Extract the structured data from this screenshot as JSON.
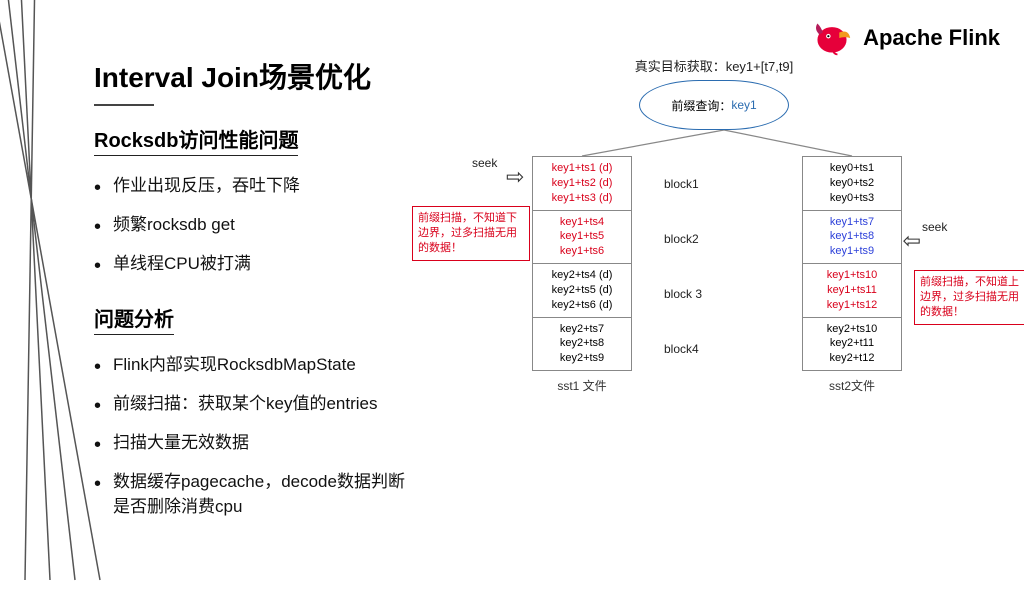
{
  "brand": "Apache Flink",
  "title": "Interval Join场景优化",
  "section1": {
    "heading": "Rocksdb访问性能问题",
    "items": [
      "作业出现反压，吞吐下降",
      "频繁rocksdb get",
      "单线程CPU被打满"
    ]
  },
  "section2": {
    "heading": "问题分析",
    "items": [
      "Flink内部实现RocksdbMapState",
      "前缀扫描：获取某个key值的entries",
      "扫描大量无效数据",
      "数据缓存pagecache，decode数据判断是否删除消费cpu"
    ]
  },
  "diagram": {
    "target": "真实目标获取：key1+[t7,t9]",
    "cloud_prefix": "前缀查询：",
    "cloud_key": "key1",
    "seek": "seek",
    "sst1_caption": "sst1 文件",
    "sst2_caption": "sst2文件",
    "blocks": [
      "block1",
      "block2",
      "block 3",
      "block4"
    ],
    "left_cells": [
      {
        "lines": [
          "key1+ts1 (d)",
          "key1+ts2 (d)",
          "key1+ts3 (d)"
        ],
        "cls": "red"
      },
      {
        "lines": [
          "key1+ts4",
          "key1+ts5",
          "key1+ts6"
        ],
        "cls": "red"
      },
      {
        "lines": [
          "key2+ts4 (d)",
          "key2+ts5 (d)",
          "key2+ts6 (d)"
        ],
        "cls": "black"
      },
      {
        "lines": [
          "key2+ts7",
          "key2+ts8",
          "key2+ts9"
        ],
        "cls": "black"
      }
    ],
    "right_cells": [
      {
        "lines": [
          "key0+ts1",
          "key0+ts2",
          "key0+ts3"
        ],
        "cls": "black"
      },
      {
        "lines": [
          "key1+ts7",
          "key1+ts8",
          "key1+ts9"
        ],
        "cls": "blue"
      },
      {
        "lines": [
          "key1+ts10",
          "key1+ts11",
          "key1+ts12"
        ],
        "cls": "red"
      },
      {
        "lines": [
          "key2+ts10",
          "key2+t11",
          "key2+t12"
        ],
        "cls": "black"
      }
    ],
    "callout_left": "前缀扫描，不知道下边界，过多扫描无用的数据！",
    "callout_right": "前缀扫描，不知道上边界，过多扫描无用的数据！"
  }
}
